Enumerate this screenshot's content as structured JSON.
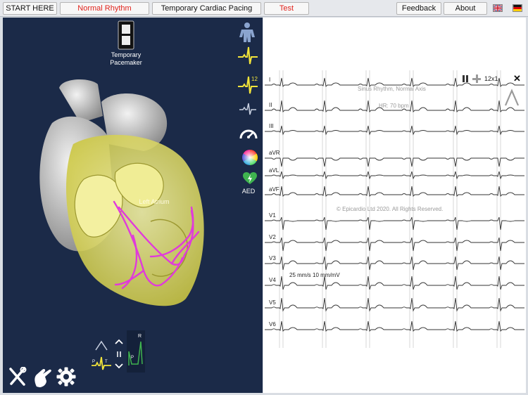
{
  "toolbar": {
    "start_label": "START HERE",
    "rhythm_label": "Normal Rhythm",
    "pacing_label": "Temporary Cardiac Pacing",
    "test_label": "Test",
    "feedback_label": "Feedback",
    "about_label": "About",
    "flags": [
      "uk-flag-icon",
      "germany-flag-icon"
    ]
  },
  "left_panel": {
    "pacemaker_label": "Temporary\nPacemaker",
    "heart_region_label": "Left Atrium",
    "aed_label": "AED",
    "side_icons": [
      "body-icon",
      "ecg-single-icon",
      "ecg-12-lead-icon",
      "ecg-faint-icon",
      "speedometer-icon",
      "color-wheel-icon",
      "aed-heart-icon"
    ],
    "bottom_icons": [
      "tools-icon",
      "hand-icon",
      "gear-icon"
    ],
    "mini_labels": {
      "p": "P",
      "t": "T",
      "r": "R",
      "r2": "R"
    }
  },
  "ecg": {
    "layout_label": "12x1",
    "rhythm_title": "Sinus Rhythm, Normal Axis",
    "hr_text": "HR: 70 bpm",
    "copyright": "© Epicardio Ltd 2020. All Rights Reserved.",
    "speed_label": "25 mm/s",
    "gain_label": "10 mm/mV",
    "leads": [
      "I",
      "II",
      "III",
      "aVR",
      "aVL",
      "aVF",
      "V1",
      "V2",
      "V3",
      "V4",
      "V5",
      "V6"
    ],
    "colors": {
      "trace": "#333333",
      "grid": "#bdbdbd",
      "accent": "#e0231c"
    }
  }
}
